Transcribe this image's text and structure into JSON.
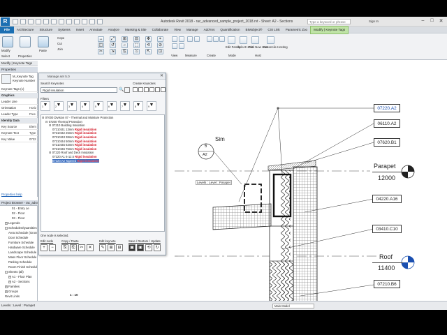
{
  "app": {
    "logo": "R",
    "title": "Autodesk Revit 2018  -  rac_advanced_sample_project_2018.rvt - Sheet: A2 - Sections",
    "search_placeholder": "Type a keyword or phrase",
    "sign_in": "Sign In"
  },
  "tabs": [
    "File",
    "Architecture",
    "Structure",
    "Systems",
    "Insert",
    "Annotate",
    "Analyze",
    "Massing & Site",
    "Collaborate",
    "View",
    "Manage",
    "Add-Ins",
    "Quantification",
    "BIMobject®",
    "CSI Link",
    "Parametric Zoo",
    "Modify | Keynote Tags"
  ],
  "active_tab": "Modify | Keynote Tags",
  "ribbon": {
    "modify_label": "Modify",
    "select_label": "Select",
    "properties_label": "Properties",
    "paste_label": "Paste",
    "small_tools": [
      "Cope",
      "Cut",
      "Join"
    ],
    "panel_labels": [
      "View",
      "Measure",
      "Create"
    ],
    "mode_buttons": [
      "Edit Family",
      "Select Host",
      "Pick New Host",
      "Reconcile Hosting"
    ],
    "group_labels": [
      "Mode",
      "Host"
    ]
  },
  "selection_bar": "Modify | Keynote Tags",
  "properties": {
    "header": "Properties",
    "type_name": "M_Keynote Tag",
    "type_sub": "Keynote Number",
    "rows": [
      {
        "label": "Keynote Tags (1)",
        "value": "",
        "cat": false
      },
      {
        "label": "Graphics",
        "value": "",
        "cat": true
      },
      {
        "label": "Leader Line",
        "value": "",
        "cat": false
      },
      {
        "label": "Orientation",
        "value": "Horiz",
        "cat": false
      },
      {
        "label": "Leader Type",
        "value": "Free",
        "cat": false
      },
      {
        "label": "Identity Data",
        "value": "",
        "cat": true
      },
      {
        "label": "Key Source",
        "value": "Elem",
        "cat": false
      },
      {
        "label": "Keynote Text",
        "value": "Type",
        "cat": false
      },
      {
        "label": "Key Value",
        "value": "0722",
        "cat": false
      }
    ],
    "help": "Properties help"
  },
  "project_browser": {
    "header": "Project Browser - rac_advanced_sample_project_2018.rvt",
    "items": [
      {
        "text": "01 - Entry Le",
        "depth": 3,
        "toggle": ""
      },
      {
        "text": "02 - Floor",
        "depth": 3,
        "toggle": ""
      },
      {
        "text": "03 - Floor",
        "depth": 3,
        "toggle": ""
      },
      {
        "text": "Legends",
        "depth": 1,
        "toggle": "+"
      },
      {
        "text": "Schedules/Quantities",
        "depth": 1,
        "toggle": "-"
      },
      {
        "text": "Area Schedule (Gross)",
        "depth": 2,
        "toggle": ""
      },
      {
        "text": "Door Schedule",
        "depth": 2,
        "toggle": ""
      },
      {
        "text": "Furniture Schedule",
        "depth": 2,
        "toggle": ""
      },
      {
        "text": "Hardware Schedule",
        "depth": 2,
        "toggle": ""
      },
      {
        "text": "Landscape Schedule",
        "depth": 2,
        "toggle": ""
      },
      {
        "text": "Mass Floor Schedule",
        "depth": 2,
        "toggle": ""
      },
      {
        "text": "Parking Schedule",
        "depth": 2,
        "toggle": ""
      },
      {
        "text": "Room Finish Schedule",
        "depth": 2,
        "toggle": ""
      },
      {
        "text": "Sheets (all)",
        "depth": 1,
        "toggle": "-"
      },
      {
        "text": "A1 - Floor Plan",
        "depth": 2,
        "toggle": "+"
      },
      {
        "text": "A2 - Sections",
        "depth": 2,
        "toggle": "+"
      },
      {
        "text": "Families",
        "depth": 1,
        "toggle": "+"
      },
      {
        "text": "Groups",
        "depth": 1,
        "toggle": "+"
      },
      {
        "text": "Revit Links",
        "depth": 1,
        "toggle": ""
      }
    ]
  },
  "status_bar": {
    "left": "Levels : Level : Parapet",
    "model": "Main Model"
  },
  "view_controls": "1 : 10",
  "dialog": {
    "title": "Manage.set 5.0",
    "search_label": "Search Keynotes",
    "search_value": "Rigid insulation",
    "create_label": "Create Keynotes",
    "filters_label": "Filters",
    "filters": [
      {
        "num": "1",
        "sub": "1"
      },
      {
        "num": "2",
        "sub": "2"
      },
      {
        "num": "3",
        "sub": "3"
      },
      {
        "num": "4",
        "sub": "4"
      },
      {
        "num": "5",
        "sub": "5"
      },
      {
        "num": "6",
        "sub": "6"
      },
      {
        "num": "7",
        "sub": "7"
      },
      {
        "num": "8",
        "sub": "8"
      },
      {
        "num": "9",
        "sub": "9"
      }
    ],
    "tree": [
      {
        "code": "07000",
        "text": "Division 07 - Thermal and Moisture Protection",
        "red": "",
        "depth": 0,
        "sel": false
      },
      {
        "code": "07200",
        "text": "Thermal Protection",
        "red": "",
        "depth": 1,
        "sel": false
      },
      {
        "code": "07210",
        "text": "Building Insulation",
        "red": "",
        "depth": 2,
        "sel": false
      },
      {
        "code": "07210.B1",
        "text": "13mm",
        "red": "Rigid insulation",
        "depth": 3,
        "sel": false
      },
      {
        "code": "07210.B2",
        "text": "25mm",
        "red": "Rigid insulation",
        "depth": 3,
        "sel": false
      },
      {
        "code": "07210.B3",
        "text": "38mm",
        "red": "Rigid insulation",
        "depth": 3,
        "sel": false
      },
      {
        "code": "07210.B4",
        "text": "50mm",
        "red": "Rigid insulation",
        "depth": 3,
        "sel": false
      },
      {
        "code": "07210.B5",
        "text": "63mm",
        "red": "Rigid insulation",
        "depth": 3,
        "sel": false
      },
      {
        "code": "07210.B6",
        "text": "75mm",
        "red": "Rigid insulation",
        "depth": 3,
        "sel": false
      },
      {
        "code": "07220",
        "text": "Roof and Deck Insulation",
        "red": "",
        "depth": 2,
        "sel": false
      },
      {
        "code": "07220.A1",
        "text": "6-12.5",
        "red": "Rigid insulation",
        "depth": 3,
        "sel": false
      },
      {
        "code": "07220.A2",
        "text": "Tapered",
        "red": "Rigid insulation",
        "depth": 3,
        "sel": true
      }
    ],
    "status": "One node is selected.",
    "groups": [
      "Edit node",
      "Copy / Paste",
      "Edit keynote",
      "Save / Restore / Update"
    ]
  },
  "drawing": {
    "keynotes": [
      "07220.A2",
      "06110.A2",
      "07620.B1",
      "04220.A16",
      "03410.C10",
      "07210.B6"
    ],
    "parapet_label": "Parapet",
    "parapet_elev": "12000",
    "roof_label": "Roof",
    "roof_elev": "11400",
    "sim": "Sim",
    "section_num": "5",
    "section_sheet": "A2",
    "tooltip": "Levels : Level : Parapet"
  }
}
